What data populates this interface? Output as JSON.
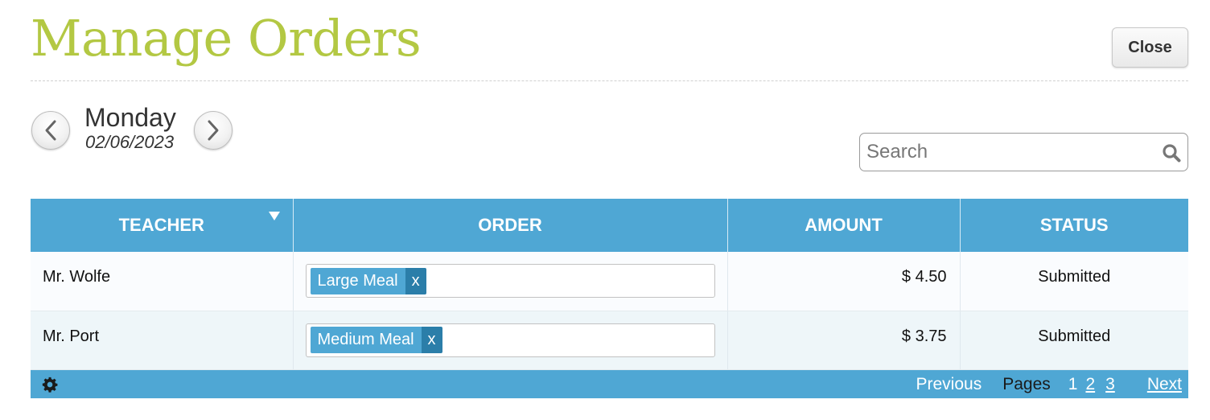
{
  "header": {
    "title": "Manage Orders",
    "close_label": "Close"
  },
  "day_nav": {
    "day": "Monday",
    "date": "02/06/2023",
    "prev_icon": "chevron-left-icon",
    "next_icon": "chevron-right-icon"
  },
  "search": {
    "placeholder": "Search",
    "value": "",
    "icon": "search-icon"
  },
  "grid": {
    "columns": [
      "TEACHER",
      "ORDER",
      "AMOUNT",
      "STATUS"
    ],
    "sorted_column": "TEACHER",
    "rows": [
      {
        "teacher": "Mr. Wolfe",
        "order_tag": "Large Meal",
        "remove": "x",
        "amount": "$ 4.50",
        "status": "Submitted"
      },
      {
        "teacher": "Mr. Port",
        "order_tag": "Medium Meal",
        "remove": "x",
        "amount": "$ 3.75",
        "status": "Submitted"
      }
    ]
  },
  "pager": {
    "previous": "Previous",
    "pages_label": "Pages",
    "current_page": "1",
    "pages": [
      "2",
      "3"
    ],
    "next": "Next"
  },
  "colors": {
    "title_green": "#b3c843",
    "grid_blue": "#4fa7d4",
    "tag_remove_blue": "#2b7ea9"
  }
}
